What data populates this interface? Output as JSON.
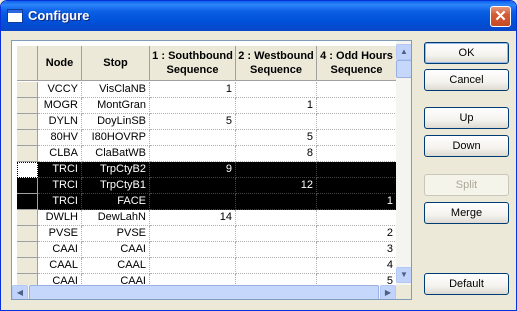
{
  "window": {
    "title": "Configure"
  },
  "columns": [
    {
      "key": "node",
      "label": "Node"
    },
    {
      "key": "stop",
      "label": "Stop"
    },
    {
      "key": "sb",
      "label": "1 : Southbound Sequence"
    },
    {
      "key": "wb",
      "label": "2 : Westbound Sequence"
    },
    {
      "key": "oh",
      "label": "4 : Odd Hours Sequence"
    }
  ],
  "rows": [
    {
      "node": "VCCY",
      "stop": "VisClaNB",
      "sb": "1",
      "wb": "",
      "oh": "",
      "selected": false
    },
    {
      "node": "MOGR",
      "stop": "MontGran",
      "sb": "",
      "wb": "1",
      "oh": "",
      "selected": false
    },
    {
      "node": "DYLN",
      "stop": "DoyLinSB",
      "sb": "5",
      "wb": "",
      "oh": "",
      "selected": false
    },
    {
      "node": "80HV",
      "stop": "I80HOVRP",
      "sb": "",
      "wb": "5",
      "oh": "",
      "selected": false
    },
    {
      "node": "CLBA",
      "stop": "ClaBatWB",
      "sb": "",
      "wb": "8",
      "oh": "",
      "selected": false
    },
    {
      "node": "TRCI",
      "stop": "TrpCtyB2",
      "sb": "9",
      "wb": "",
      "oh": "",
      "selected": true
    },
    {
      "node": "TRCI",
      "stop": "TrpCtyB1",
      "sb": "",
      "wb": "12",
      "oh": "",
      "selected": true
    },
    {
      "node": "TRCI",
      "stop": "FACE",
      "sb": "",
      "wb": "",
      "oh": "1",
      "selected": true
    },
    {
      "node": "DWLH",
      "stop": "DewLahN",
      "sb": "14",
      "wb": "",
      "oh": "",
      "selected": false
    },
    {
      "node": "PVSE",
      "stop": "PVSE",
      "sb": "",
      "wb": "",
      "oh": "2",
      "selected": false
    },
    {
      "node": "CAAI",
      "stop": "CAAI",
      "sb": "",
      "wb": "",
      "oh": "3",
      "selected": false
    },
    {
      "node": "CAAL",
      "stop": "CAAL",
      "sb": "",
      "wb": "",
      "oh": "4",
      "selected": false
    },
    {
      "node": "CAAI",
      "stop": "CAAI",
      "sb": "",
      "wb": "",
      "oh": "5",
      "selected": false
    }
  ],
  "buttons": {
    "ok": "OK",
    "cancel": "Cancel",
    "up": "Up",
    "down": "Down",
    "split": "Split",
    "merge": "Merge",
    "default": "Default"
  },
  "icons": {
    "close": "close-icon",
    "window": "window-icon"
  }
}
